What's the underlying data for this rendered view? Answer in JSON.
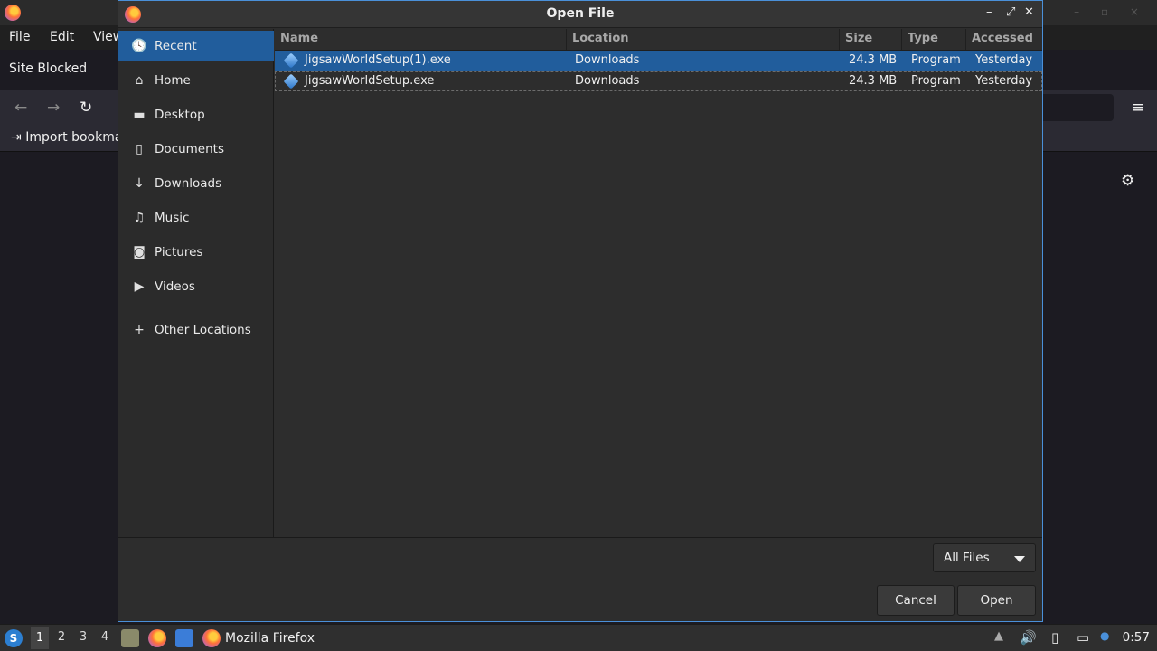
{
  "firefox": {
    "menu": {
      "file": "File",
      "edit": "Edit",
      "view": "View"
    },
    "tab_title": "Site Blocked",
    "bookmarks_import": "Import bookmarks..."
  },
  "dialog": {
    "title": "Open File",
    "sidebar": [
      {
        "label": "Recent",
        "icon": "clock-icon",
        "glyph": "🕓"
      },
      {
        "label": "Home",
        "icon": "home-icon",
        "glyph": "⌂"
      },
      {
        "label": "Desktop",
        "icon": "folder-icon",
        "glyph": "▬"
      },
      {
        "label": "Documents",
        "icon": "document-icon",
        "glyph": "▯"
      },
      {
        "label": "Downloads",
        "icon": "download-icon",
        "glyph": "↓"
      },
      {
        "label": "Music",
        "icon": "music-icon",
        "glyph": "♫"
      },
      {
        "label": "Pictures",
        "icon": "camera-icon",
        "glyph": "◙"
      },
      {
        "label": "Videos",
        "icon": "video-icon",
        "glyph": "▶"
      },
      {
        "label": "Other Locations",
        "icon": "plus-icon",
        "glyph": "+"
      }
    ],
    "columns": {
      "name": "Name",
      "location": "Location",
      "size": "Size",
      "type": "Type",
      "accessed": "Accessed"
    },
    "files": [
      {
        "name": "JigsawWorldSetup(1).exe",
        "location": "Downloads",
        "size": "24.3 MB",
        "type": "Program",
        "accessed": "Yesterday"
      },
      {
        "name": "JigsawWorldSetup.exe",
        "location": "Downloads",
        "size": "24.3 MB",
        "type": "Program",
        "accessed": "Yesterday"
      }
    ],
    "filter": "All Files",
    "cancel": "Cancel",
    "open": "Open"
  },
  "taskbar": {
    "workspaces": [
      "1",
      "2",
      "3",
      "4"
    ],
    "task_label": "Mozilla Firefox",
    "clock": "0:57"
  }
}
